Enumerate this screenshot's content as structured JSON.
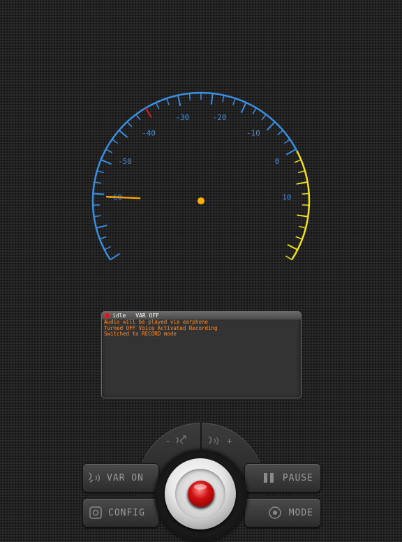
{
  "meter": {
    "scale_labels": [
      "-30",
      "-20",
      "-10",
      "0",
      "10",
      "-40",
      "-50",
      "-60"
    ],
    "needle_value": -60,
    "colors": {
      "scale": "#3a8fe0",
      "peak": "#f0e020",
      "warn": "#e02020",
      "needle": "#f5a000",
      "hub": "#ffb000"
    }
  },
  "console": {
    "status": "idle",
    "var_status": "VAR OFF",
    "log": [
      "Audio will be played via earphone",
      "Turned OFF Voice Activated Recording",
      "Switched to RECORD mode"
    ]
  },
  "controls": {
    "sensitivity_minus": "-",
    "sensitivity_plus": "+",
    "var_button_label": "VAR ON",
    "pause_button_label": "PAUSE",
    "config_button_label": "CONFIG",
    "mode_button_label": "MODE",
    "icons": {
      "minus": "sensitivity-down-icon",
      "plus": "sensitivity-up-icon",
      "var": "voice-activation-icon",
      "pause": "pause-icon",
      "config": "config-icon",
      "mode": "mode-icon",
      "record": "record-icon"
    }
  }
}
